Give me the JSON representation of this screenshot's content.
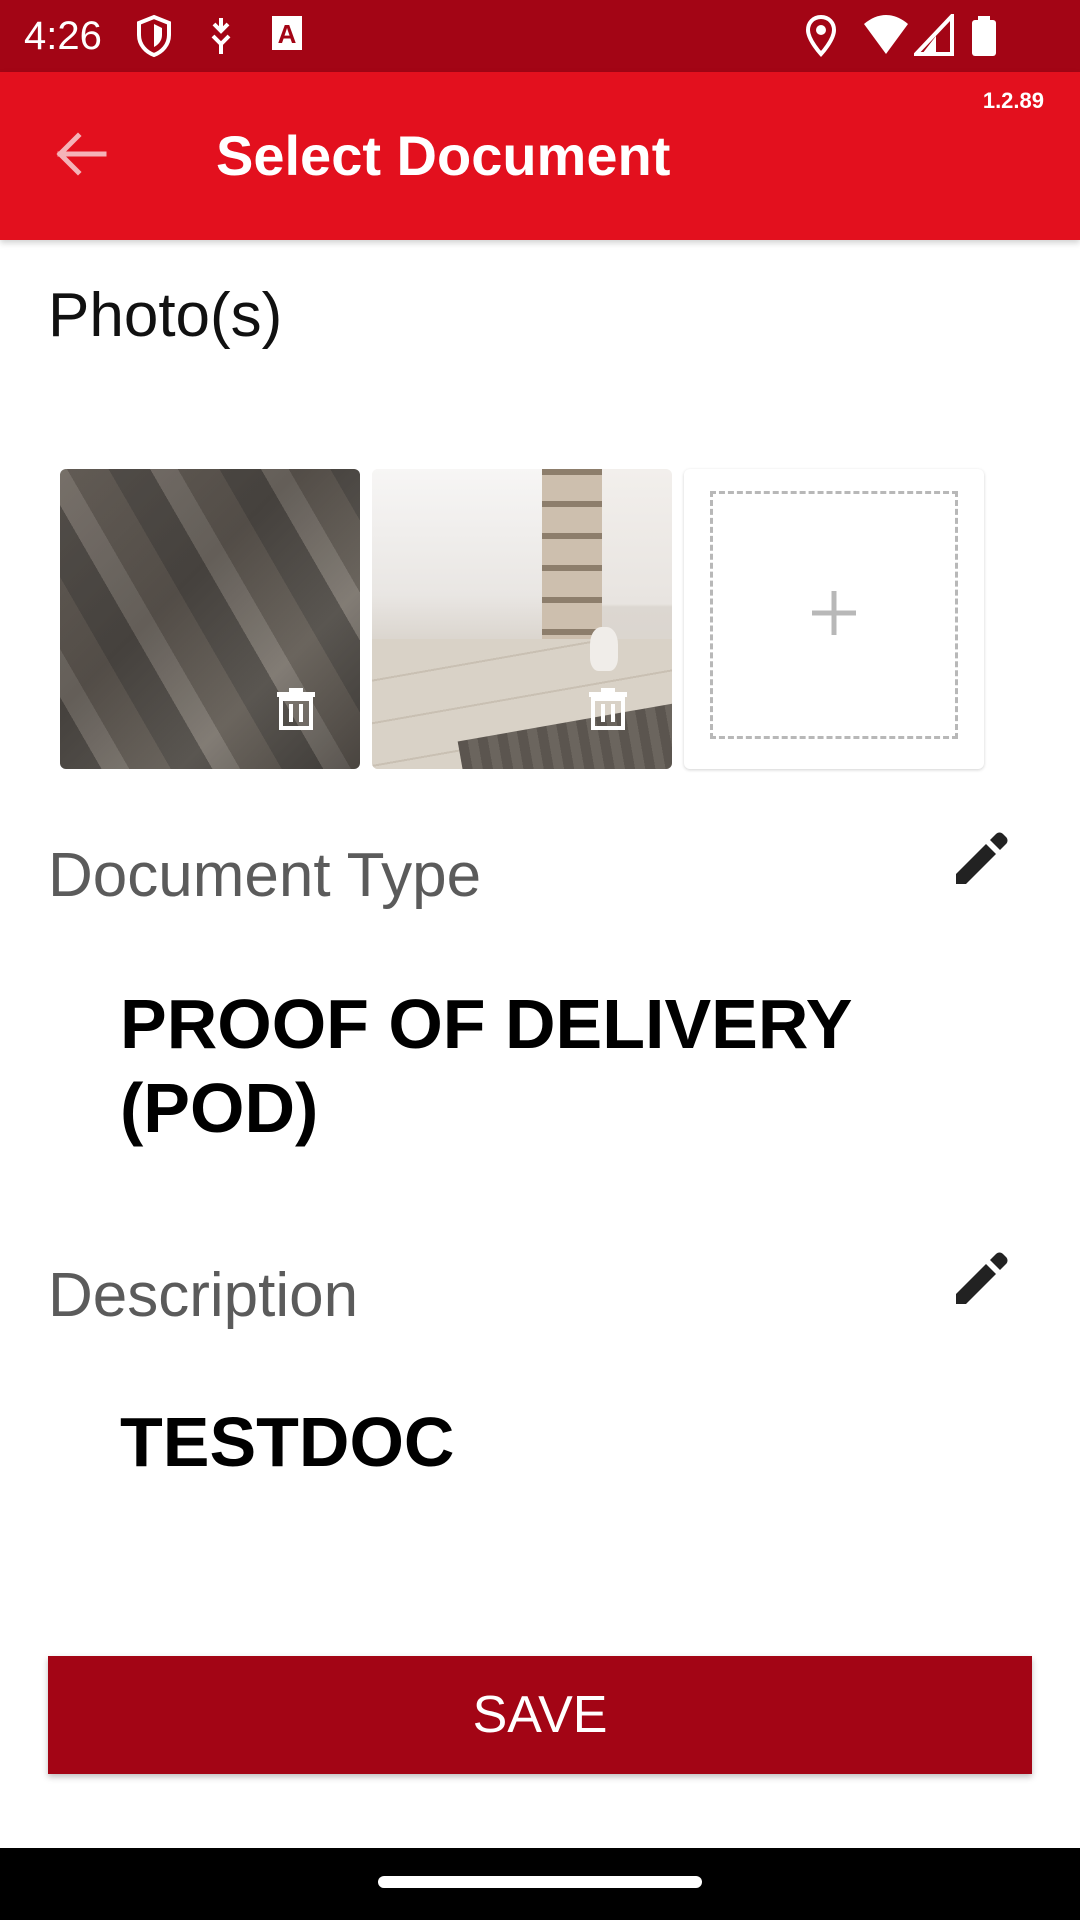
{
  "status_bar": {
    "time": "4:26",
    "icons": [
      "shield-icon",
      "download-arrows-icon",
      "font-a-icon",
      "location-icon",
      "wifi-icon",
      "signal-icon",
      "battery-icon"
    ]
  },
  "app_bar": {
    "title": "Select Document",
    "version": "1.2.89",
    "back_icon": "arrow-left-icon"
  },
  "photos": {
    "section_title": "Photo(s)",
    "items": [
      {
        "name": "photo-1",
        "delete_icon": "trash-icon"
      },
      {
        "name": "photo-2",
        "delete_icon": "trash-icon"
      }
    ],
    "add_icon": "plus-icon"
  },
  "document_type": {
    "label": "Document Type",
    "value": "PROOF OF DELIVERY (POD)",
    "edit_icon": "pencil-icon"
  },
  "description": {
    "label": "Description",
    "value": "TESTDOC",
    "edit_icon": "pencil-icon"
  },
  "actions": {
    "save_label": "SAVE"
  },
  "colors": {
    "status_bar": "#a30515",
    "app_bar": "#e3101e",
    "save_button": "#a30515"
  }
}
